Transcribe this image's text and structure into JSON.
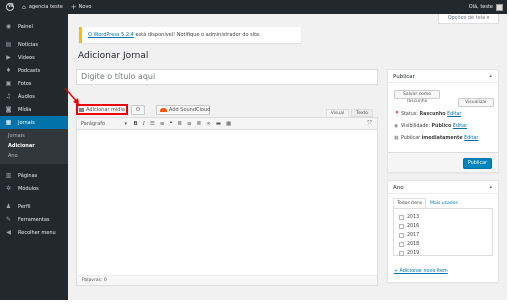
{
  "adminbar": {
    "site_name": "agencia teste",
    "new_label": "Novo",
    "user_greeting": "Olá, teste"
  },
  "sidebar": {
    "items": [
      {
        "label": "Painel",
        "icon": "dashboard-icon"
      },
      {
        "label": "Notícias",
        "icon": "news-icon"
      },
      {
        "label": "Vídeos",
        "icon": "video-icon"
      },
      {
        "label": "Podcasts",
        "icon": "podcast-icon"
      },
      {
        "label": "Fotos",
        "icon": "photo-icon"
      },
      {
        "label": "Áudios",
        "icon": "audio-icon"
      },
      {
        "label": "Mídia",
        "icon": "media-icon"
      },
      {
        "label": "Jornais",
        "icon": "newspaper-icon"
      }
    ],
    "submenu": [
      "Jornais",
      "Adicionar",
      "Ano"
    ],
    "items_bottom": [
      {
        "label": "Páginas",
        "icon": "pages-icon"
      },
      {
        "label": "Módulos",
        "icon": "modules-icon"
      },
      {
        "label": "Perfil",
        "icon": "profile-icon"
      },
      {
        "label": "Ferramentas",
        "icon": "tools-icon"
      },
      {
        "label": "Recolher menu",
        "icon": "collapse-icon"
      }
    ]
  },
  "screen_options": "Opções de tela ▾",
  "notice": {
    "link": "O WordPress 5.2.4",
    "text": " está disponível! Notifique o administrador do site."
  },
  "page_title": "Adicionar Jornal",
  "title_placeholder": "Digite o título aqui",
  "media": {
    "add_media": "Adicionar mídia",
    "soundcloud": "Add SoundCloud"
  },
  "editor": {
    "tab_visual": "Visual",
    "tab_text": "Texto",
    "format": "Parágrafo",
    "word_count": "Palavras: 0"
  },
  "publish": {
    "title": "Publicar",
    "save_draft": "Salvar como rascunho",
    "preview": "Visualizar",
    "status_label": "Status: ",
    "status_value": "Rascunho",
    "status_edit": "Editar",
    "visibility_label": "Visibilidade: ",
    "visibility_value": "Público",
    "visibility_edit": "Editar",
    "schedule_label": "Publicar ",
    "schedule_value": "imediatamente",
    "schedule_edit": "Editar",
    "publish_btn": "Publicar"
  },
  "ano": {
    "title": "Ano",
    "tab_all": "Todos itens",
    "tab_popular": "Mais usados",
    "years": [
      "2013",
      "2016",
      "2017",
      "2018",
      "2019"
    ],
    "add_new": "+ Adicionar novo item"
  },
  "colors": {
    "accent": "#0073aa",
    "sidebar_bg": "#23282d",
    "highlight_box": "#ee0000",
    "notice_border": "#ffb900"
  }
}
